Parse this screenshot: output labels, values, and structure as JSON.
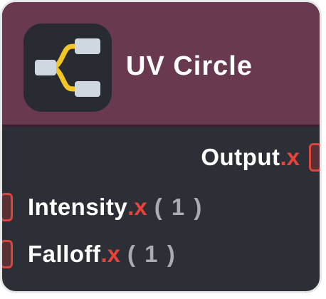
{
  "node": {
    "title": "UV Circle",
    "icon": "node-graph-icon",
    "header_color": "#693950",
    "body_color": "#2c3036"
  },
  "outputs": [
    {
      "name": "Output",
      "component": ".x"
    }
  ],
  "inputs": [
    {
      "name": "Intensity",
      "component": ".x",
      "value": "( 1 )"
    },
    {
      "name": "Falloff",
      "component": ".x",
      "value": "( 1 )"
    }
  ],
  "colors": {
    "component_accent": "#e8433c",
    "socket_border": "#d7463e",
    "value_text": "#a9adb2"
  }
}
